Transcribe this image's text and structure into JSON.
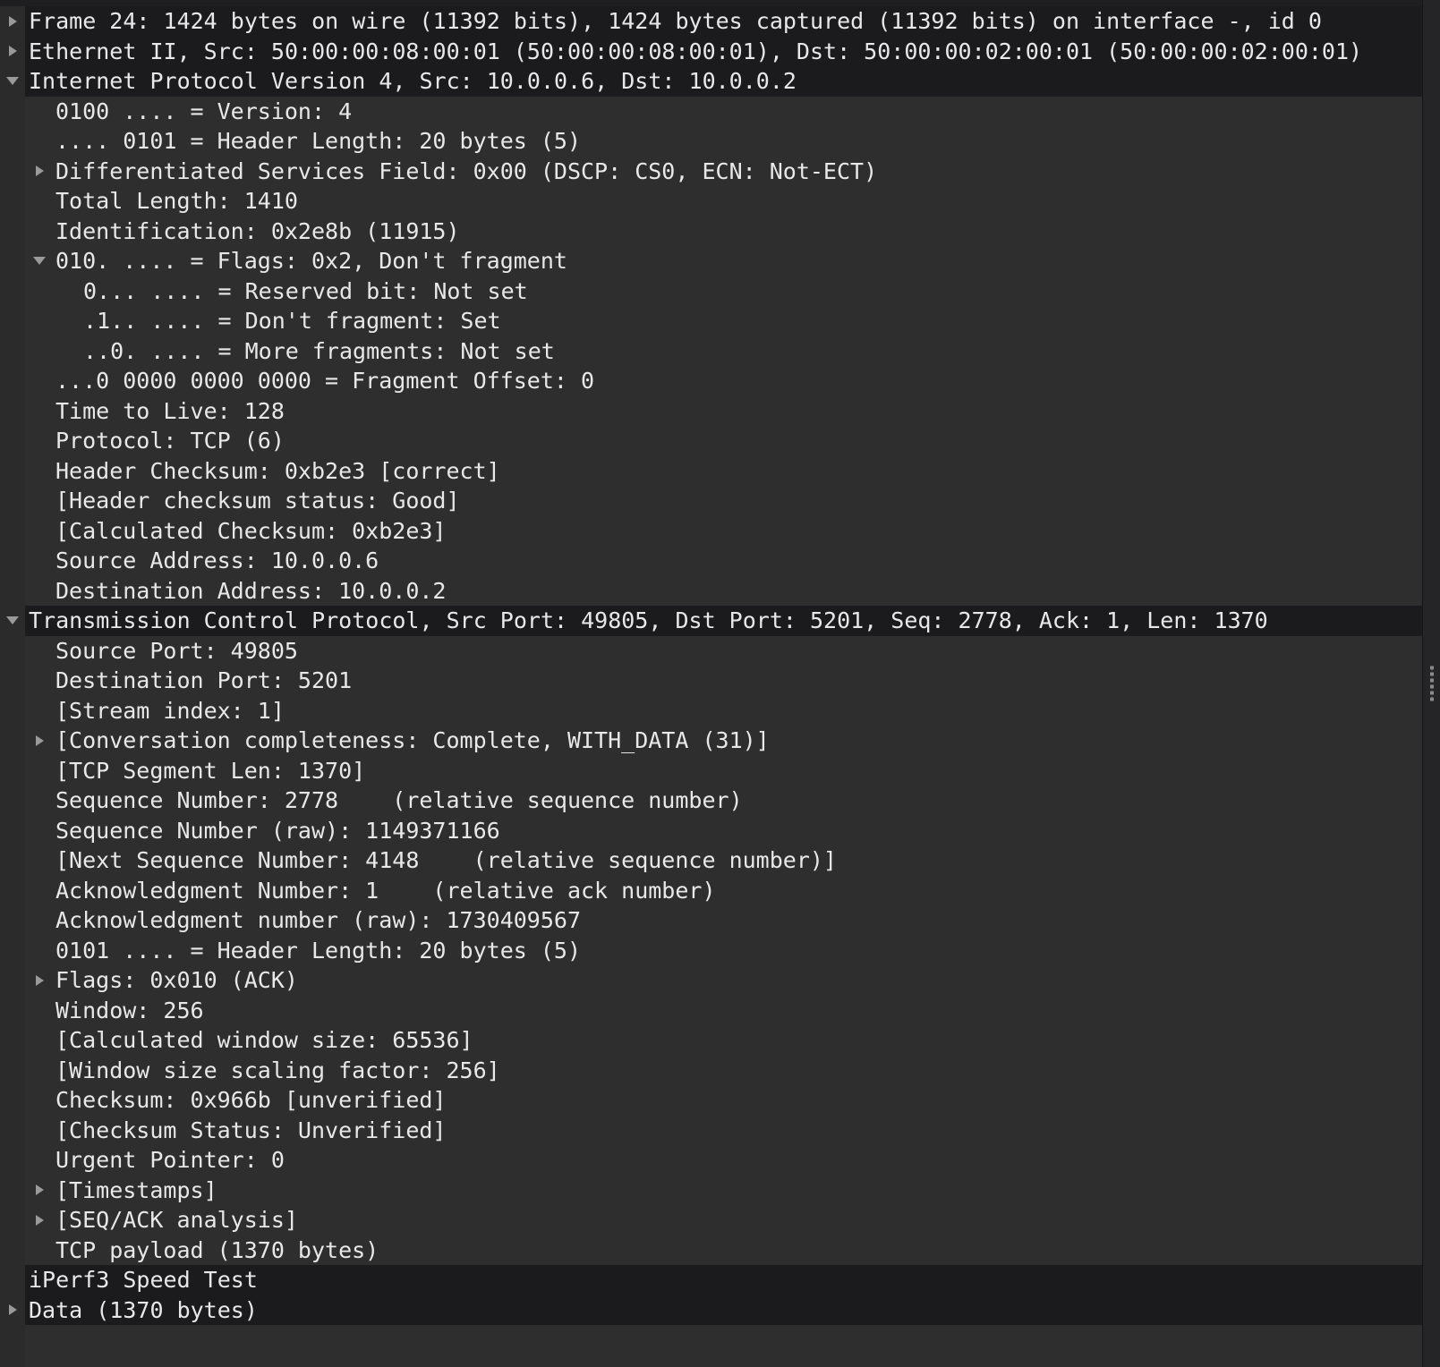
{
  "pane": {
    "name": "packet-details",
    "theme": {
      "background": "#2e2e2e",
      "band_background": "#1b1b1d",
      "gutter_background": "#2b2b2b",
      "text_color": "#e8e8e8",
      "triangle_color": "#9a9a9a",
      "splitter_background": "#252527"
    }
  },
  "rows": [
    {
      "text": "Frame 24: 1424 bytes on wire (11392 bits), 1424 bytes captured (11392 bits) on interface -, id 0",
      "level": 0,
      "expander": "collapsed",
      "band": true,
      "name": "tree-item-frame"
    },
    {
      "text": "Ethernet II, Src: 50:00:00:08:00:01 (50:00:00:08:00:01), Dst: 50:00:00:02:00:01 (50:00:00:02:00:01)",
      "level": 0,
      "expander": "collapsed",
      "band": true,
      "name": "tree-item-ethernet"
    },
    {
      "text": "Internet Protocol Version 4, Src: 10.0.0.6, Dst: 10.0.0.2",
      "level": 0,
      "expander": "expanded",
      "band": true,
      "name": "tree-item-ipv4"
    },
    {
      "text": "0100 .... = Version: 4",
      "level": 1,
      "expander": "none",
      "band": false,
      "name": "tree-item-ip-version"
    },
    {
      "text": ".... 0101 = Header Length: 20 bytes (5)",
      "level": 1,
      "expander": "none",
      "band": false,
      "name": "tree-item-ip-header-length"
    },
    {
      "text": "Differentiated Services Field: 0x00 (DSCP: CS0, ECN: Not-ECT)",
      "level": 1,
      "expander": "collapsed",
      "band": false,
      "name": "tree-item-dsfield"
    },
    {
      "text": "Total Length: 1410",
      "level": 1,
      "expander": "none",
      "band": false,
      "name": "tree-item-total-length"
    },
    {
      "text": "Identification: 0x2e8b (11915)",
      "level": 1,
      "expander": "none",
      "band": false,
      "name": "tree-item-identification"
    },
    {
      "text": "010. .... = Flags: 0x2, Don't fragment",
      "level": 1,
      "expander": "expanded",
      "band": false,
      "name": "tree-item-ip-flags"
    },
    {
      "text": "0... .... = Reserved bit: Not set",
      "level": 2,
      "expander": "none",
      "band": false,
      "name": "tree-item-reserved-bit"
    },
    {
      "text": ".1.. .... = Don't fragment: Set",
      "level": 2,
      "expander": "none",
      "band": false,
      "name": "tree-item-dont-fragment"
    },
    {
      "text": "..0. .... = More fragments: Not set",
      "level": 2,
      "expander": "none",
      "band": false,
      "name": "tree-item-more-fragments"
    },
    {
      "text": "...0 0000 0000 0000 = Fragment Offset: 0",
      "level": 1,
      "expander": "none",
      "band": false,
      "name": "tree-item-fragment-offset"
    },
    {
      "text": "Time to Live: 128",
      "level": 1,
      "expander": "none",
      "band": false,
      "name": "tree-item-ttl"
    },
    {
      "text": "Protocol: TCP (6)",
      "level": 1,
      "expander": "none",
      "band": false,
      "name": "tree-item-protocol"
    },
    {
      "text": "Header Checksum: 0xb2e3 [correct]",
      "level": 1,
      "expander": "none",
      "band": false,
      "name": "tree-item-header-checksum"
    },
    {
      "text": "[Header checksum status: Good]",
      "level": 1,
      "expander": "none",
      "band": false,
      "name": "tree-item-header-checksum-status"
    },
    {
      "text": "[Calculated Checksum: 0xb2e3]",
      "level": 1,
      "expander": "none",
      "band": false,
      "name": "tree-item-calculated-checksum"
    },
    {
      "text": "Source Address: 10.0.0.6",
      "level": 1,
      "expander": "none",
      "band": false,
      "name": "tree-item-source-address"
    },
    {
      "text": "Destination Address: 10.0.0.2",
      "level": 1,
      "expander": "none",
      "band": false,
      "name": "tree-item-destination-address"
    },
    {
      "text": "Transmission Control Protocol, Src Port: 49805, Dst Port: 5201, Seq: 2778, Ack: 1, Len: 1370",
      "level": 0,
      "expander": "expanded",
      "band": true,
      "name": "tree-item-tcp"
    },
    {
      "text": "Source Port: 49805",
      "level": 1,
      "expander": "none",
      "band": false,
      "name": "tree-item-source-port"
    },
    {
      "text": "Destination Port: 5201",
      "level": 1,
      "expander": "none",
      "band": false,
      "name": "tree-item-destination-port"
    },
    {
      "text": "[Stream index: 1]",
      "level": 1,
      "expander": "none",
      "band": false,
      "name": "tree-item-stream-index"
    },
    {
      "text": "[Conversation completeness: Complete, WITH_DATA (31)]",
      "level": 1,
      "expander": "collapsed",
      "band": false,
      "name": "tree-item-conversation-completeness"
    },
    {
      "text": "[TCP Segment Len: 1370]",
      "level": 1,
      "expander": "none",
      "band": false,
      "name": "tree-item-tcp-segment-len"
    },
    {
      "text": "Sequence Number: 2778    (relative sequence number)",
      "level": 1,
      "expander": "none",
      "band": false,
      "name": "tree-item-sequence-number"
    },
    {
      "text": "Sequence Number (raw): 1149371166",
      "level": 1,
      "expander": "none",
      "band": false,
      "name": "tree-item-sequence-number-raw"
    },
    {
      "text": "[Next Sequence Number: 4148    (relative sequence number)]",
      "level": 1,
      "expander": "none",
      "band": false,
      "name": "tree-item-next-sequence-number"
    },
    {
      "text": "Acknowledgment Number: 1    (relative ack number)",
      "level": 1,
      "expander": "none",
      "band": false,
      "name": "tree-item-acknowledgment-number"
    },
    {
      "text": "Acknowledgment number (raw): 1730409567",
      "level": 1,
      "expander": "none",
      "band": false,
      "name": "tree-item-acknowledgment-number-raw"
    },
    {
      "text": "0101 .... = Header Length: 20 bytes (5)",
      "level": 1,
      "expander": "none",
      "band": false,
      "name": "tree-item-tcp-header-length"
    },
    {
      "text": "Flags: 0x010 (ACK)",
      "level": 1,
      "expander": "collapsed",
      "band": false,
      "name": "tree-item-tcp-flags"
    },
    {
      "text": "Window: 256",
      "level": 1,
      "expander": "none",
      "band": false,
      "name": "tree-item-window"
    },
    {
      "text": "[Calculated window size: 65536]",
      "level": 1,
      "expander": "none",
      "band": false,
      "name": "tree-item-calculated-window-size"
    },
    {
      "text": "[Window size scaling factor: 256]",
      "level": 1,
      "expander": "none",
      "band": false,
      "name": "tree-item-window-scaling-factor"
    },
    {
      "text": "Checksum: 0x966b [unverified]",
      "level": 1,
      "expander": "none",
      "band": false,
      "name": "tree-item-tcp-checksum"
    },
    {
      "text": "[Checksum Status: Unverified]",
      "level": 1,
      "expander": "none",
      "band": false,
      "name": "tree-item-tcp-checksum-status"
    },
    {
      "text": "Urgent Pointer: 0",
      "level": 1,
      "expander": "none",
      "band": false,
      "name": "tree-item-urgent-pointer"
    },
    {
      "text": "[Timestamps]",
      "level": 1,
      "expander": "collapsed",
      "band": false,
      "name": "tree-item-timestamps"
    },
    {
      "text": "[SEQ/ACK analysis]",
      "level": 1,
      "expander": "collapsed",
      "band": false,
      "name": "tree-item-seq-ack-analysis"
    },
    {
      "text": "TCP payload (1370 bytes)",
      "level": 1,
      "expander": "none",
      "band": false,
      "name": "tree-item-tcp-payload"
    },
    {
      "text": "iPerf3 Speed Test",
      "level": 0,
      "expander": "none",
      "band": true,
      "name": "tree-item-iperf3-speed-test"
    },
    {
      "text": "Data (1370 bytes)",
      "level": 0,
      "expander": "collapsed",
      "band": true,
      "name": "tree-item-data"
    }
  ]
}
